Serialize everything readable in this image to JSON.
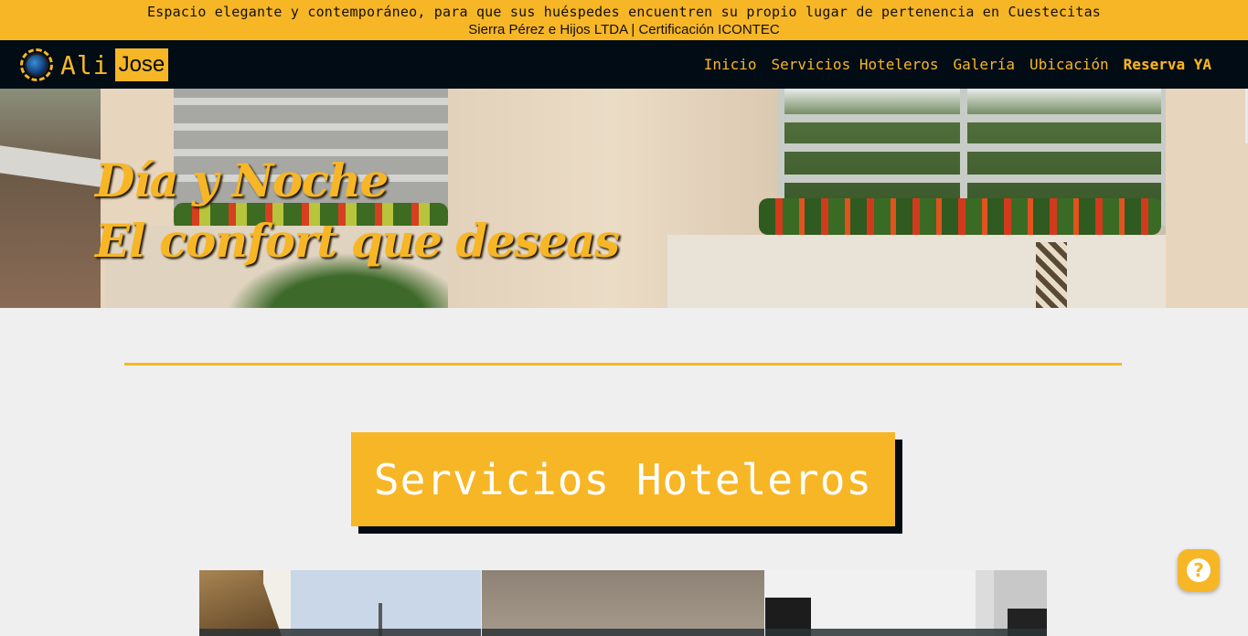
{
  "top_banner": {
    "tagline": "Espacio elegante y contemporáneo, para que sus huéspedes encuentren su propio lugar de pertenencia en Cuestecitas",
    "company": "Sierra Pérez e Hijos LTDA | Certificación ICONTEC"
  },
  "brand": {
    "part1": "Ali",
    "part2": "Jose"
  },
  "nav": {
    "items": [
      "Inicio",
      "Servicios Hoteleros",
      "Galería",
      "Ubicación"
    ],
    "cta": "Reserva YA"
  },
  "hero": {
    "line1": "Día y Noche",
    "line2": "El confort que deseas"
  },
  "section": {
    "title": "Servicios Hoteleros"
  },
  "help_button": {
    "glyph": "?"
  },
  "colors": {
    "accent": "#f7b626",
    "navbar": "#010c15",
    "background": "#efefef"
  }
}
